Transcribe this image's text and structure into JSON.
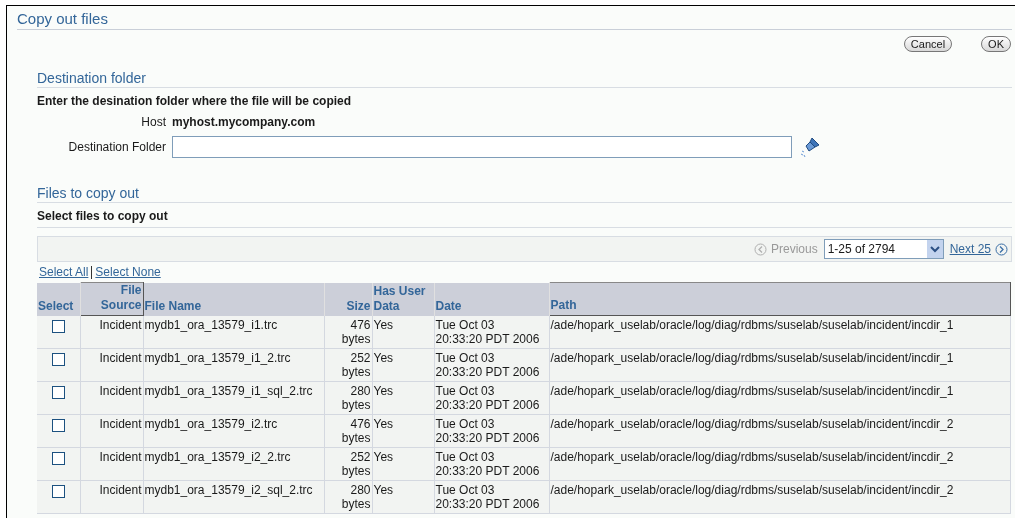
{
  "page": {
    "title": "Copy out files"
  },
  "buttons": [
    {
      "label": "Cancel"
    },
    {
      "label": "OK"
    }
  ],
  "destination": {
    "heading": "Destination folder",
    "instruction": "Enter the desination folder where the file will be copied",
    "host_label": "Host",
    "host": "myhost.mycompany.com",
    "folder_label": "Destination Folder"
  },
  "files": {
    "heading": "Files to copy out",
    "instruction": "Select files to copy out",
    "pagination": {
      "previous": "Previous",
      "previous_disabled": true,
      "range": "1-25 of 2794",
      "next": "Next 25"
    },
    "select_all": "Select All",
    "select_none": "Select None",
    "columns": [
      "Select",
      "File Source",
      "File Name",
      "Size",
      "Has User Data",
      "Date",
      "Path"
    ],
    "rows": [
      {
        "checked": false,
        "source": "Incident",
        "name": "mydb1_ora_13579_i1.trc",
        "size": "476 bytes",
        "has_user_data": "Yes",
        "date": "Tue Oct 03 20:33:20 PDT 2006",
        "path": "/ade/hopark_uselab/oracle/log/diag/rdbms/suselab/suselab/incident/incdir_1"
      },
      {
        "checked": false,
        "source": "Incident",
        "name": "mydb1_ora_13579_i1_2.trc",
        "size": "252 bytes",
        "has_user_data": "Yes",
        "date": "Tue Oct 03 20:33:20 PDT 2006",
        "path": "/ade/hopark_uselab/oracle/log/diag/rdbms/suselab/suselab/incident/incdir_1"
      },
      {
        "checked": false,
        "source": "Incident",
        "name": "mydb1_ora_13579_i1_sql_2.trc",
        "size": "280 bytes",
        "has_user_data": "Yes",
        "date": "Tue Oct 03 20:33:20 PDT 2006",
        "path": "/ade/hopark_uselab/oracle/log/diag/rdbms/suselab/suselab/incident/incdir_1"
      },
      {
        "checked": false,
        "source": "Incident",
        "name": "mydb1_ora_13579_i2.trc",
        "size": "476 bytes",
        "has_user_data": "Yes",
        "date": "Tue Oct 03 20:33:20 PDT 2006",
        "path": "/ade/hopark_uselab/oracle/log/diag/rdbms/suselab/suselab/incident/incdir_2"
      },
      {
        "checked": false,
        "source": "Incident",
        "name": "mydb1_ora_13579_i2_2.trc",
        "size": "252 bytes",
        "has_user_data": "Yes",
        "date": "Tue Oct 03 20:33:20 PDT 2006",
        "path": "/ade/hopark_uselab/oracle/log/diag/rdbms/suselab/suselab/incident/incdir_2"
      },
      {
        "checked": false,
        "source": "Incident",
        "name": "mydb1_ora_13579_i2_sql_2.trc",
        "size": "280 bytes",
        "has_user_data": "Yes",
        "date": "Tue Oct 03 20:33:20 PDT 2006",
        "path": "/ade/hopark_uselab/oracle/log/diag/rdbms/suselab/suselab/incident/incdir_2"
      }
    ]
  }
}
